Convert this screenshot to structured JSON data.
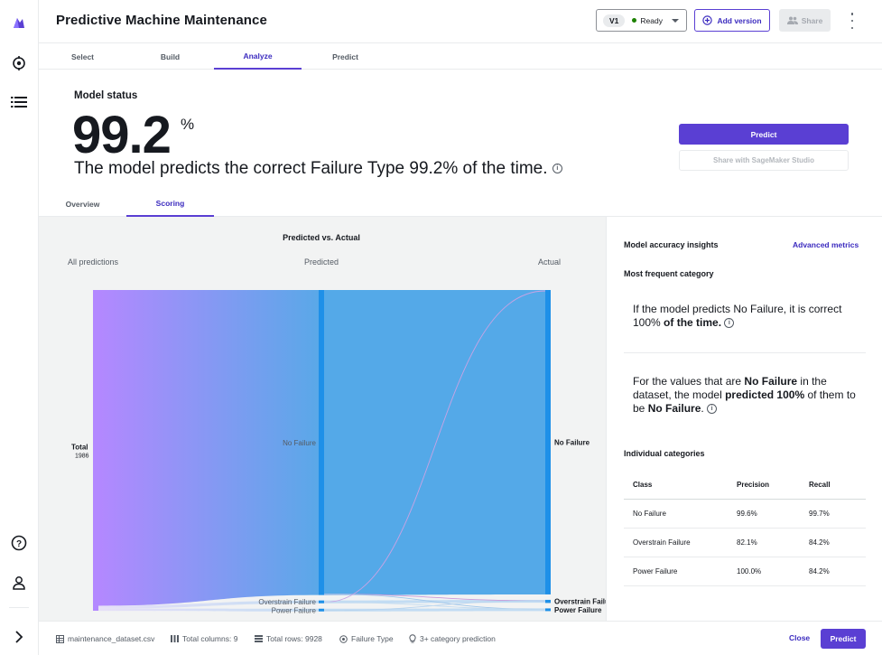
{
  "header": {
    "title": "Predictive Machine Maintenance",
    "version": "V1",
    "status": "Ready",
    "add_version": "Add version",
    "share": "Share"
  },
  "main_tabs": [
    "Select",
    "Build",
    "Analyze",
    "Predict"
  ],
  "model_status": {
    "label": "Model status",
    "accuracy": "99.2",
    "unit": "%",
    "sentence": "The model predicts the correct Failure Type 99.2% of the time.",
    "predict_button": "Predict",
    "share_button": "Share with SageMaker Studio"
  },
  "sub_tabs": [
    "Overview",
    "Scoring"
  ],
  "chart_data": {
    "type": "sankey",
    "title": "Predicted vs. Actual",
    "column_headers": [
      "All predictions",
      "Predicted",
      "Actual"
    ],
    "source": {
      "label": "Total",
      "value": 1986
    },
    "predicted": [
      {
        "name": "No Failure",
        "value": 1955
      },
      {
        "name": "Overstrain Failure",
        "value": 18
      },
      {
        "name": "Power Failure",
        "value": 13
      }
    ],
    "actual": [
      {
        "name": "No Failure",
        "value": 1951
      },
      {
        "name": "Overstrain Failure",
        "value": 20
      },
      {
        "name": "Power Failure",
        "value": 15
      }
    ],
    "colors": {
      "source": "#b388ff",
      "node": "#1e90e8",
      "flow": "#4ea6e8"
    }
  },
  "insights": {
    "title": "Model accuracy insights",
    "advanced_link": "Advanced metrics",
    "most_frequent": "Most frequent category",
    "p1_a": "If the model predicts No Failure, it is correct 100%",
    "p1_b": " of the time.",
    "p2_a": "For the values that are ",
    "p2_b": "No Failure",
    "p2_c": " in the dataset, the model ",
    "p2_d": "predicted 100%",
    "p2_e": " of them to be ",
    "p2_f": "No Failure",
    "p2_g": ".",
    "individual": "Individual categories",
    "table": {
      "headers": [
        "Class",
        "Precision",
        "Recall"
      ],
      "rows": [
        [
          "No Failure",
          "99.6%",
          "99.7%"
        ],
        [
          "Overstrain Failure",
          "82.1%",
          "84.2%"
        ],
        [
          "Power Failure",
          "100.0%",
          "84.2%"
        ]
      ]
    }
  },
  "footer": {
    "dataset": "maintenance_dataset.csv",
    "columns": "Total columns: 9",
    "rows": "Total rows: 9928",
    "target": "Failure Type",
    "pred_type": "3+ category prediction",
    "close": "Close",
    "predict": "Predict"
  }
}
